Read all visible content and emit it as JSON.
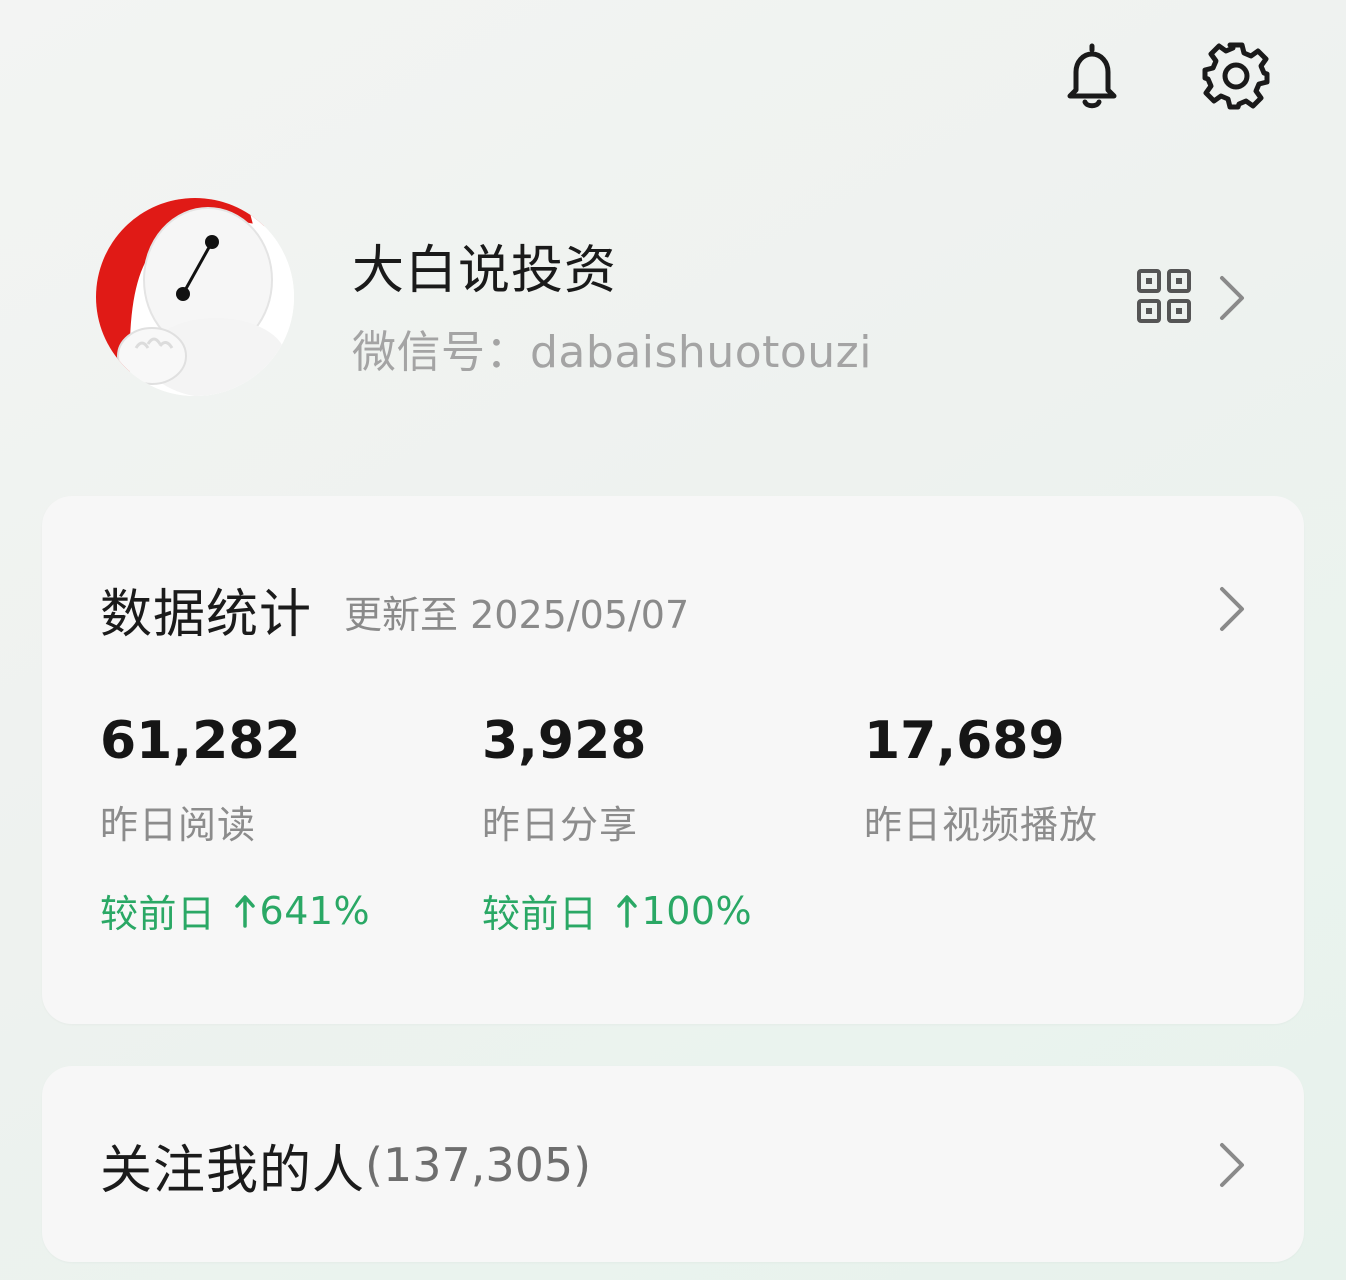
{
  "header": {
    "icons": [
      "bell-icon",
      "gear-icon"
    ]
  },
  "profile": {
    "name": "大白说投资",
    "wechat_id": "微信号：dabaishuotouzi",
    "avatar": "baymax-avatar",
    "qr_icon": "qr-code-icon"
  },
  "stats": {
    "title": "数据统计",
    "updated": "更新至 2025/05/07",
    "metrics": [
      {
        "value": "61,282",
        "label": "昨日阅读",
        "compare_label": "较前日",
        "change": "641%"
      },
      {
        "value": "3,928",
        "label": "昨日分享",
        "compare_label": "较前日",
        "change": "100%"
      },
      {
        "value": "17,689",
        "label": "昨日视频播放",
        "compare_label": "",
        "change": ""
      }
    ]
  },
  "followers": {
    "label": "关注我的人",
    "count": "(137,305)"
  },
  "colors": {
    "accent_green": "#2aa865",
    "avatar_red": "#e01a16",
    "text_muted": "#8c8c8c"
  }
}
